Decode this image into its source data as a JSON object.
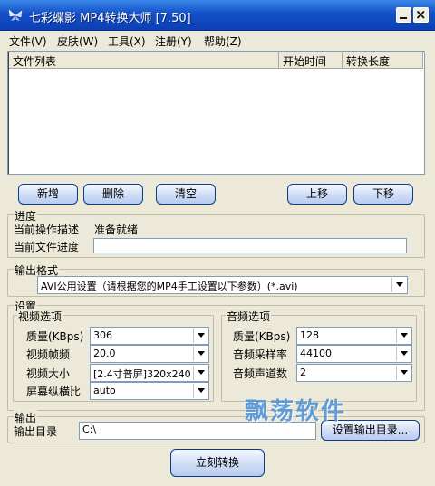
{
  "window": {
    "title": "七彩蝶影 MP4转换大师 [7.50]"
  },
  "menu": [
    "文件(V)",
    "皮肤(W)",
    "工具(X)",
    "注册(Y)",
    "帮助(Z)"
  ],
  "list": {
    "columns": [
      "文件列表",
      "开始时间",
      "转换长度"
    ],
    "rows": []
  },
  "toolbar": {
    "add": "新增",
    "delete": "删除",
    "clear": "清空",
    "up": "上移",
    "down": "下移"
  },
  "progress": {
    "title": "进度",
    "desc_label": "当前操作描述",
    "desc_value": "准备就绪",
    "file_label": "当前文件进度",
    "file_value": ""
  },
  "output_format": {
    "title": "输出格式",
    "value": "AVI公用设置（请根据您的MP4手工设置以下参数）(*.avi)"
  },
  "settings": {
    "title": "设置",
    "video": {
      "title": "视频选项",
      "quality_label": "质量(KBps)",
      "quality_value": "306",
      "fps_label": "视频帧频",
      "fps_value": "20.0",
      "size_label": "视频大小",
      "size_value": "[2.4寸普屏]320x240",
      "aspect_label": "屏幕纵横比",
      "aspect_value": "auto"
    },
    "audio": {
      "title": "音频选项",
      "quality_label": "质量(KBps)",
      "quality_value": "128",
      "rate_label": "音频采样率",
      "rate_value": "44100",
      "channels_label": "音频声道数",
      "channels_value": "2"
    }
  },
  "output": {
    "title": "输出",
    "dir_label": "输出目录",
    "dir_value": "C:\\",
    "set_dir_button": "设置输出目录..."
  },
  "convert_button": "立刻转换",
  "watermark": "飘荡软件"
}
